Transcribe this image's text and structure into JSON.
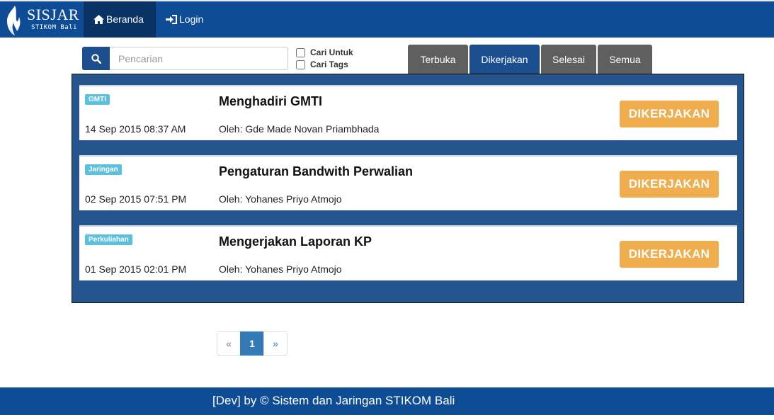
{
  "brand": {
    "title": "SISJAR",
    "subtitle": "STIKOM Bali",
    "logo_icon": "flame-icon"
  },
  "nav": {
    "home_label": "Beranda",
    "home_icon": "home-icon",
    "login_label": "Login",
    "login_icon": "sign-in-icon"
  },
  "search": {
    "placeholder": "Pencarian",
    "value": "",
    "icon": "search-icon",
    "checkbox_1": "Cari Untuk",
    "checkbox_2": "Cari Tags"
  },
  "tabs": [
    {
      "label": "Terbuka",
      "active": false
    },
    {
      "label": "Dikerjakan",
      "active": true
    },
    {
      "label": "Selesai",
      "active": false
    },
    {
      "label": "Semua",
      "active": false
    }
  ],
  "items": [
    {
      "tag": "GMTI",
      "date": "14 Sep 2015 08:37 AM",
      "title": "Menghadiri GMTI",
      "author": "Oleh: Gde Made Novan Priambhada",
      "status": "DIKERJAKAN"
    },
    {
      "tag": "Jaringan",
      "date": "02 Sep 2015 07:51 PM",
      "title": "Pengaturan Bandwith Perwalian",
      "author": "Oleh: Yohanes Priyo Atmojo",
      "status": "DIKERJAKAN"
    },
    {
      "tag": "Perkuliahan",
      "date": "01 Sep 2015 02:01 PM",
      "title": "Mengerjakan Laporan KP",
      "author": "Oleh: Yohanes Priyo Atmojo",
      "status": "DIKERJAKAN"
    }
  ],
  "pagination": {
    "prev": "«",
    "current": "1",
    "next": "»"
  },
  "footer": {
    "text": "[Dev] by © Sistem dan Jaringan STIKOM Bali"
  },
  "colors": {
    "navbar": "#0f4c96",
    "panel": "#25558f",
    "status_button": "#f0ad4e",
    "badge": "#5bc0de",
    "active_tab": "#1c4f8f",
    "inactive_tab": "#5f5f5f"
  }
}
